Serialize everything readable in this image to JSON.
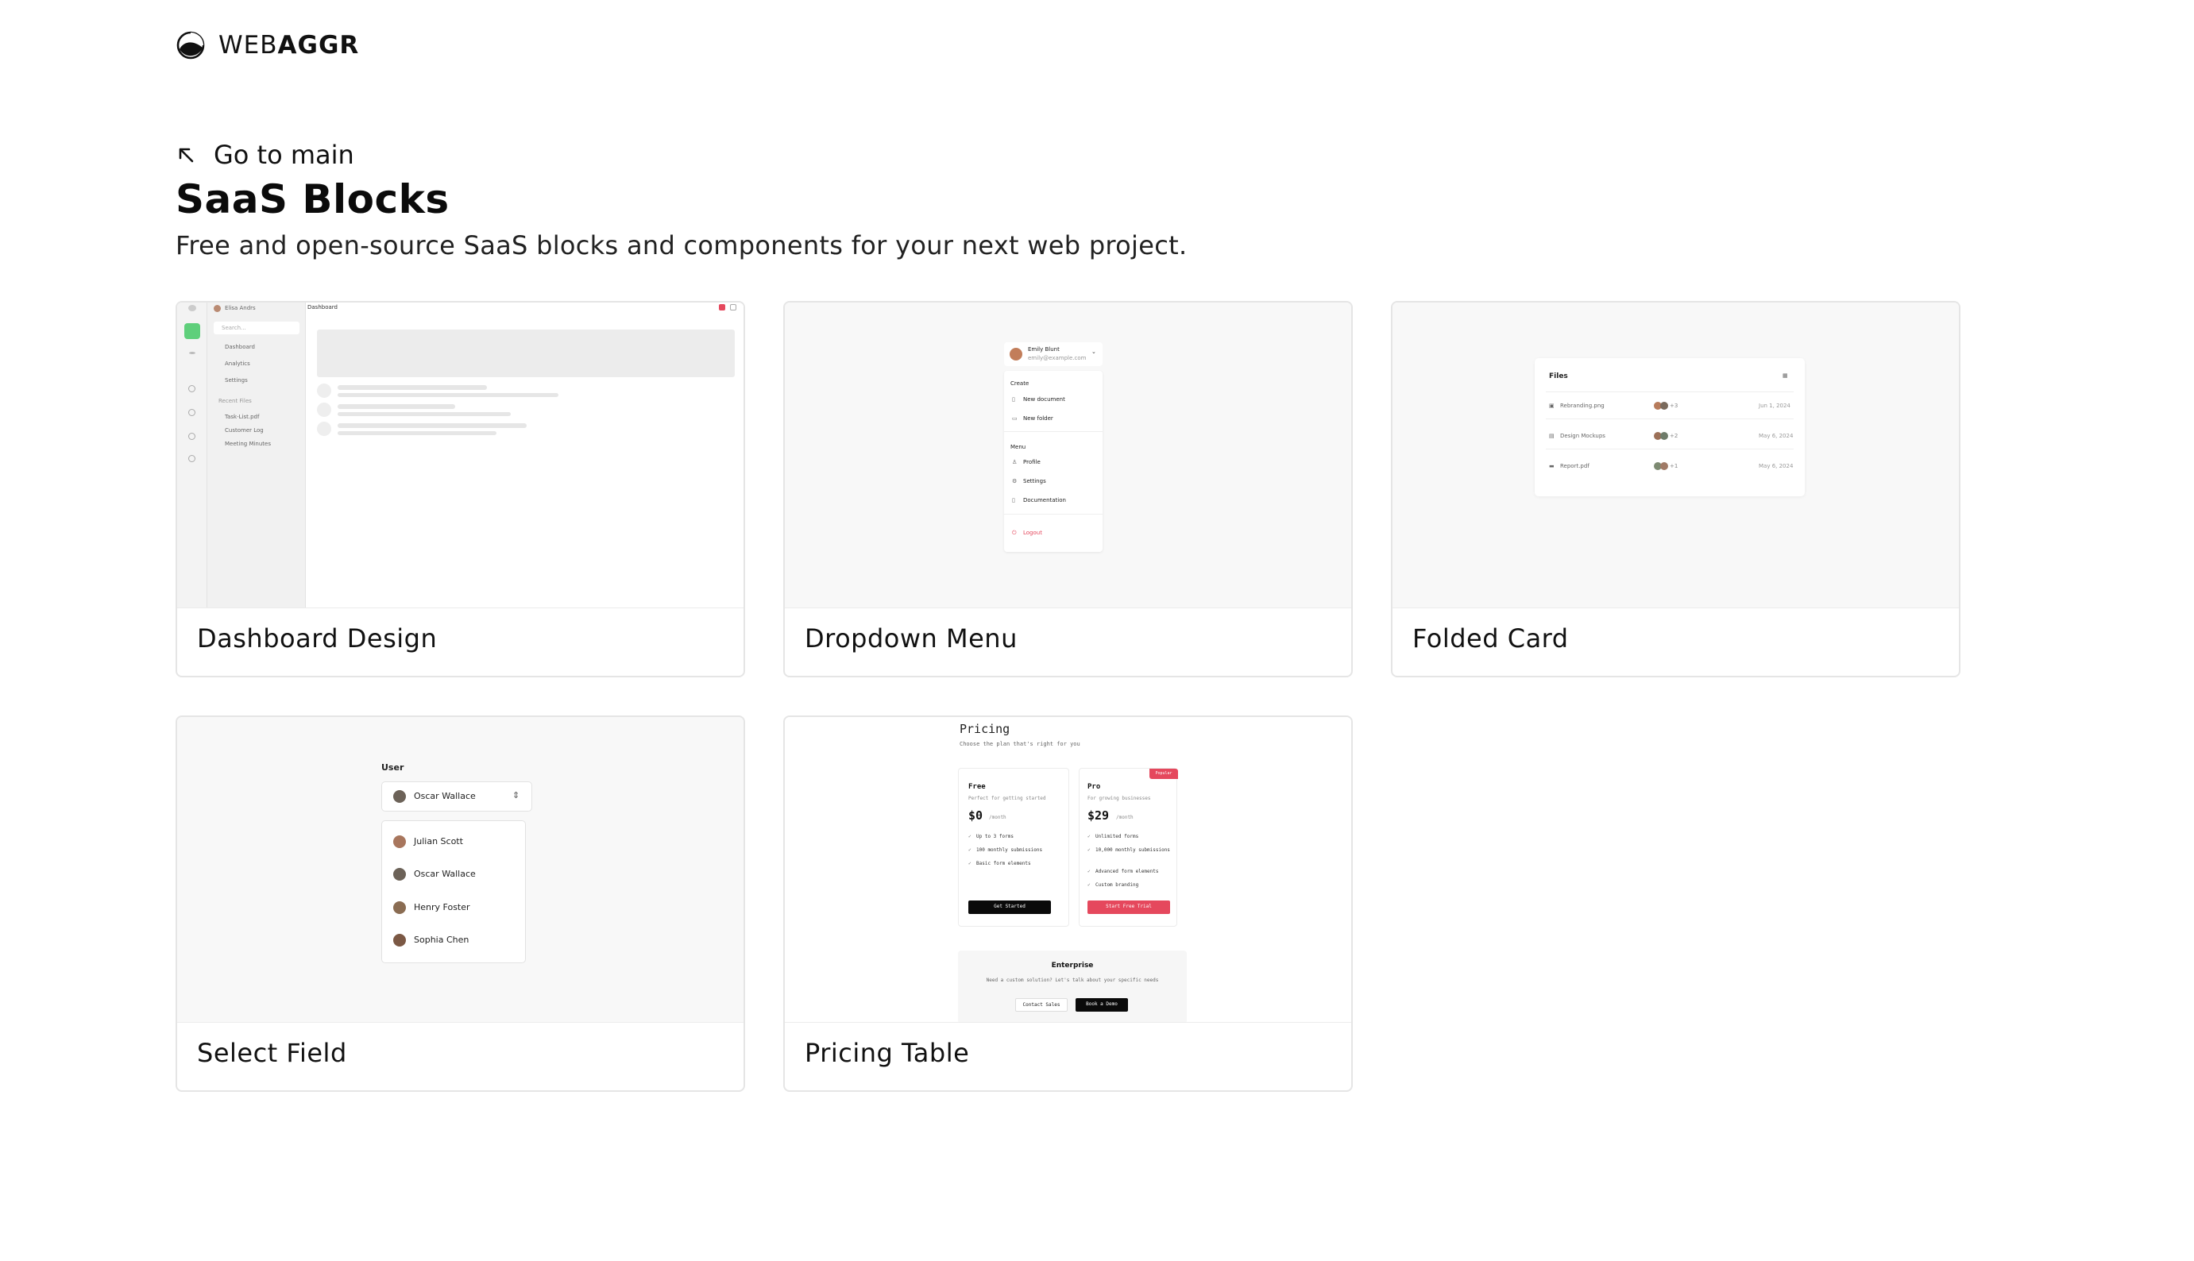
{
  "brand": {
    "prefix": "WEB",
    "suffix": "AGGR"
  },
  "nav": {
    "back_label": "Go to main"
  },
  "page": {
    "title": "SaaS Blocks",
    "subtitle": "Free and open-source SaaS blocks and components for your next web project."
  },
  "cards": [
    {
      "title": "Dashboard Design"
    },
    {
      "title": "Dropdown Menu"
    },
    {
      "title": "Folded Card"
    },
    {
      "title": "Select Field"
    },
    {
      "title": "Pricing Table"
    }
  ],
  "dashboard_preview": {
    "user": "Elisa Andrs",
    "header": "Dashboard",
    "search": "Search...",
    "nav": [
      "Dashboard",
      "Analytics",
      "Settings"
    ],
    "section": "Recent Files",
    "files": [
      "Task-List.pdf",
      "Customer Log",
      "Meeting Minutes"
    ]
  },
  "dropdown_preview": {
    "name": "Emily Blunt",
    "email": "emily@example.com",
    "create_label": "Create",
    "create_items": [
      "New document",
      "New folder"
    ],
    "menu_label": "Menu",
    "menu_items": [
      "Profile",
      "Settings",
      "Documentation"
    ],
    "logout": "Logout"
  },
  "folded_preview": {
    "title": "Files",
    "rows": [
      {
        "name": "Rebranding.png",
        "extra": "+3",
        "date": "Jun 1, 2024"
      },
      {
        "name": "Design Mockups",
        "extra": "+2",
        "date": "May 6, 2024"
      },
      {
        "name": "Report.pdf",
        "extra": "+1",
        "date": "May 6, 2024"
      }
    ]
  },
  "select_preview": {
    "label": "User",
    "selected": "Oscar Wallace",
    "options": [
      "Julian Scott",
      "Oscar Wallace",
      "Henry Foster",
      "Sophia Chen"
    ]
  },
  "pricing_preview": {
    "title": "Pricing",
    "subtitle": "Choose the plan that's right for you",
    "free": {
      "name": "Free",
      "desc": "Perfect for getting started",
      "price": "$0",
      "period": "/month",
      "features": [
        "Up to 3 forms",
        "100 monthly submissions",
        "Basic form elements"
      ],
      "cta": "Get Started"
    },
    "pro": {
      "badge": "Popular",
      "name": "Pro",
      "desc": "For growing businesses",
      "price": "$29",
      "period": "/month",
      "features": [
        "Unlimited forms",
        "10,000 monthly submissions",
        "Advanced form elements",
        "Custom branding"
      ],
      "cta": "Start Free Trial"
    },
    "enterprise": {
      "name": "Enterprise",
      "desc": "Need a custom solution? Let's talk about your specific needs",
      "contact": "Contact Sales",
      "demo": "Book a Demo"
    }
  },
  "colors": {
    "accent_red": "#e5485d",
    "accent_green": "#5fcf7b",
    "border": "#e5e5e5",
    "preview_bg": "#f8f8f8"
  }
}
